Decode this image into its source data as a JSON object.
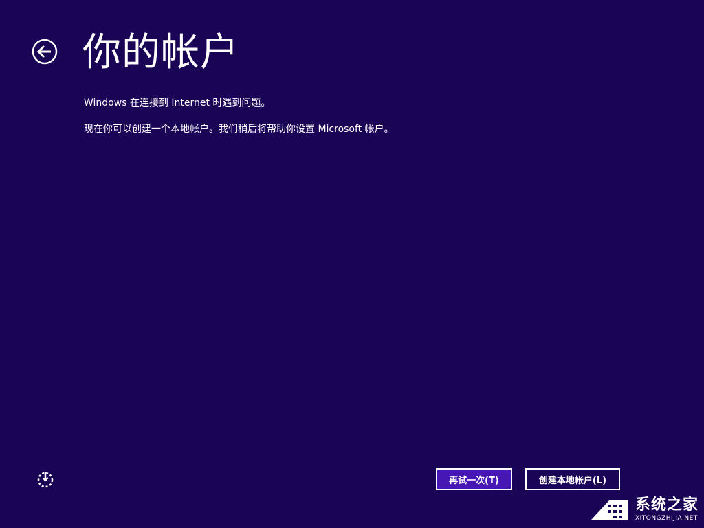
{
  "page": {
    "title": "你的帐户",
    "message_line1": "Windows 在连接到 Internet 时遇到问题。",
    "message_line2": "现在你可以创建一个本地帐户。我们稍后将帮助你设置 Microsoft 帐户。"
  },
  "buttons": {
    "retry": "再试一次(T)",
    "create_local": "创建本地帐户(L)"
  },
  "icons": {
    "back": "back-arrow-icon",
    "ease_of_access": "ease-of-access-icon"
  },
  "watermark": {
    "text_cn": "系统之家",
    "text_en": "XITONGZHIJIA.NET"
  },
  "colors": {
    "background": "#1a0456",
    "primary_button": "#4617b4",
    "text": "#ffffff"
  }
}
